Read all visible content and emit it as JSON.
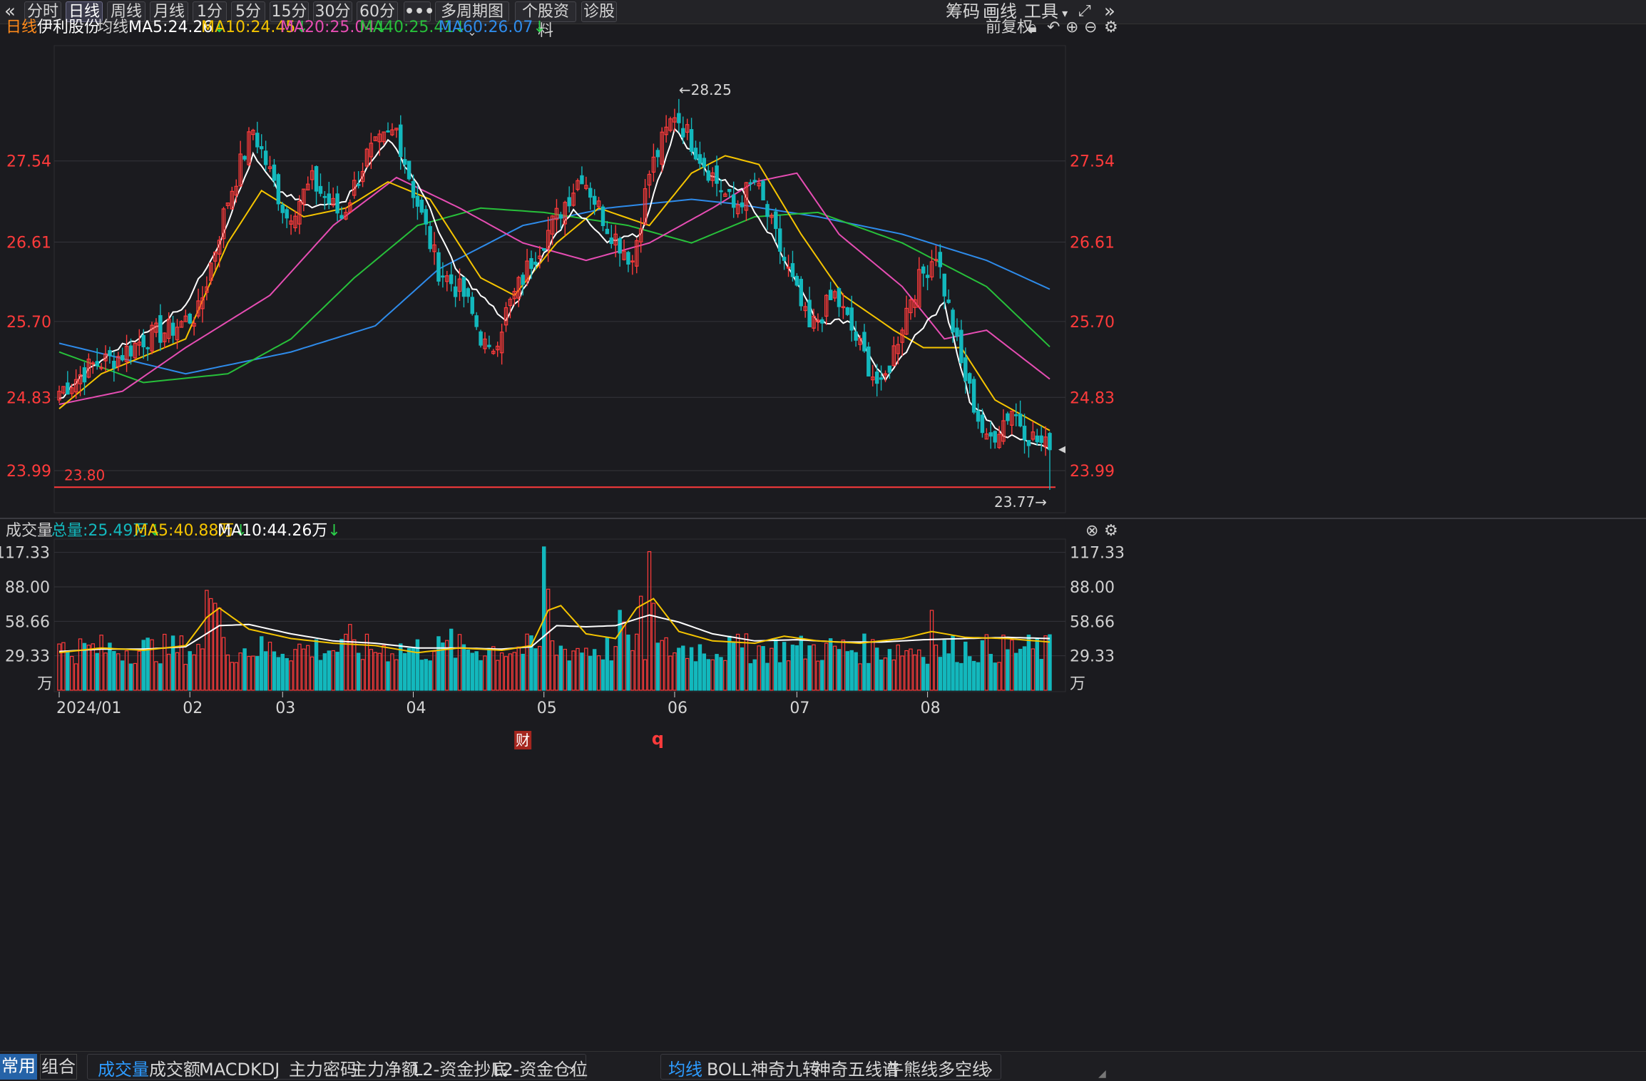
{
  "toolbar": {
    "collapse_icon": "double-chevron-left-icon",
    "periods": [
      "分时",
      "日线",
      "周线",
      "月线",
      "1分",
      "5分",
      "15分",
      "30分",
      "60分"
    ],
    "active_period": "日线",
    "more_label": "•••",
    "multi_period_label": "多周期图",
    "stock_info_label": "个股资料",
    "diagnose_label": "诊股",
    "chips_label": "筹码",
    "draw_label": "画线",
    "tools_label": "工具",
    "fullscreen_icon": "fullscreen-icon",
    "expand_icon": "double-chevron-right-icon"
  },
  "price_header": {
    "period": "日线",
    "stock_name": "伊利股份",
    "ma_label": "均线",
    "ma5": "MA5:24.26",
    "ma10": "MA10:24.45",
    "ma20": "MA20:25.04",
    "ma40": "MA40:25.41",
    "ma60": "MA60:26.07",
    "adjust_label": "前复权"
  },
  "volume_header": {
    "title": "成交量",
    "total": "总量:25.49万",
    "ma5": "MA5:40.88万",
    "ma10": "MA10:44.26万"
  },
  "colors": {
    "up": "#ff3b3b",
    "down": "#13b8bd",
    "ma5": "#ffffff",
    "ma10": "#f5c400",
    "ma20": "#e64db3",
    "ma40": "#27c03a",
    "ma60": "#2e8bea",
    "axis_label": "#ff3b3b",
    "background": "#1b1b1f"
  },
  "chart_data": [
    {
      "type": "candlestick",
      "ylim": [
        23.5,
        28.6
      ],
      "yticks": [
        "27.54",
        "26.61",
        "25.70",
        "24.83",
        "23.99"
      ],
      "support_label": "23.80",
      "support_value": 23.8,
      "high_label": "←28.25",
      "low_label": "23.77→",
      "finance_marker": "财",
      "q_marker": "q",
      "start_value": 24.9,
      "end_value": 24.23,
      "high_value": 28.25,
      "low_value": 23.77,
      "waypoints": [
        [
          0,
          24.9
        ],
        [
          8,
          25.2
        ],
        [
          14,
          25.3
        ],
        [
          20,
          25.5
        ],
        [
          26,
          25.6
        ],
        [
          33,
          25.8
        ],
        [
          40,
          27.1
        ],
        [
          46,
          27.9
        ],
        [
          54,
          26.9
        ],
        [
          60,
          27.3
        ],
        [
          67,
          26.9
        ],
        [
          73,
          27.6
        ],
        [
          80,
          27.9
        ],
        [
          84,
          27.2
        ],
        [
          90,
          26.3
        ],
        [
          96,
          26.0
        ],
        [
          102,
          25.3
        ],
        [
          106,
          25.8
        ],
        [
          112,
          26.4
        ],
        [
          118,
          26.9
        ],
        [
          124,
          27.4
        ],
        [
          130,
          26.8
        ],
        [
          136,
          26.4
        ],
        [
          140,
          27.4
        ],
        [
          146,
          28.1
        ],
        [
          152,
          27.6
        ],
        [
          160,
          27.0
        ],
        [
          165,
          27.3
        ],
        [
          172,
          26.4
        ],
        [
          178,
          25.6
        ],
        [
          184,
          26.0
        ],
        [
          190,
          25.4
        ],
        [
          195,
          24.9
        ],
        [
          202,
          26.0
        ],
        [
          208,
          26.5
        ],
        [
          214,
          25.2
        ],
        [
          220,
          24.3
        ],
        [
          226,
          24.7
        ],
        [
          230,
          24.4
        ],
        [
          235,
          24.23
        ]
      ],
      "ma_lines": {
        "ma60": [
          [
            0,
            25.45
          ],
          [
            30,
            25.1
          ],
          [
            55,
            25.35
          ],
          [
            75,
            25.65
          ],
          [
            90,
            26.3
          ],
          [
            110,
            26.8
          ],
          [
            130,
            27.0
          ],
          [
            150,
            27.1
          ],
          [
            160,
            27.05
          ],
          [
            180,
            26.9
          ],
          [
            200,
            26.7
          ],
          [
            220,
            26.4
          ],
          [
            235,
            26.07
          ]
        ],
        "ma40": [
          [
            0,
            25.35
          ],
          [
            20,
            25.0
          ],
          [
            40,
            25.1
          ],
          [
            55,
            25.5
          ],
          [
            70,
            26.2
          ],
          [
            85,
            26.8
          ],
          [
            100,
            27.0
          ],
          [
            115,
            26.95
          ],
          [
            135,
            26.8
          ],
          [
            150,
            26.6
          ],
          [
            165,
            26.9
          ],
          [
            180,
            26.95
          ],
          [
            200,
            26.6
          ],
          [
            220,
            26.1
          ],
          [
            235,
            25.41
          ]
        ],
        "ma20": [
          [
            0,
            24.75
          ],
          [
            15,
            24.9
          ],
          [
            30,
            25.4
          ],
          [
            50,
            26.0
          ],
          [
            65,
            26.8
          ],
          [
            80,
            27.35
          ],
          [
            95,
            27.0
          ],
          [
            110,
            26.6
          ],
          [
            125,
            26.4
          ],
          [
            140,
            26.6
          ],
          [
            155,
            27.0
          ],
          [
            165,
            27.3
          ],
          [
            175,
            27.4
          ],
          [
            185,
            26.7
          ],
          [
            200,
            26.1
          ],
          [
            210,
            25.5
          ],
          [
            220,
            25.6
          ],
          [
            235,
            25.04
          ]
        ],
        "ma10": [
          [
            0,
            24.7
          ],
          [
            10,
            25.1
          ],
          [
            20,
            25.3
          ],
          [
            30,
            25.5
          ],
          [
            40,
            26.6
          ],
          [
            48,
            27.2
          ],
          [
            58,
            26.9
          ],
          [
            68,
            27.0
          ],
          [
            78,
            27.3
          ],
          [
            88,
            27.1
          ],
          [
            100,
            26.2
          ],
          [
            108,
            26.0
          ],
          [
            118,
            26.6
          ],
          [
            128,
            27.0
          ],
          [
            140,
            26.8
          ],
          [
            150,
            27.4
          ],
          [
            158,
            27.6
          ],
          [
            166,
            27.5
          ],
          [
            176,
            26.7
          ],
          [
            186,
            26.0
          ],
          [
            198,
            25.6
          ],
          [
            205,
            25.4
          ],
          [
            214,
            25.4
          ],
          [
            222,
            24.8
          ],
          [
            235,
            24.45
          ]
        ],
        "ma5": [
          [
            0,
            24.8
          ],
          [
            6,
            25.1
          ],
          [
            14,
            25.4
          ],
          [
            22,
            25.6
          ],
          [
            30,
            25.9
          ],
          [
            38,
            26.6
          ],
          [
            46,
            27.6
          ],
          [
            52,
            27.2
          ],
          [
            60,
            27.0
          ],
          [
            68,
            27.1
          ],
          [
            78,
            27.8
          ],
          [
            86,
            27.2
          ],
          [
            94,
            26.3
          ],
          [
            100,
            26.0
          ],
          [
            106,
            25.7
          ],
          [
            114,
            26.4
          ],
          [
            122,
            27.0
          ],
          [
            130,
            26.6
          ],
          [
            138,
            26.7
          ],
          [
            146,
            27.9
          ],
          [
            154,
            27.4
          ],
          [
            162,
            27.2
          ],
          [
            170,
            26.6
          ],
          [
            180,
            25.7
          ],
          [
            188,
            25.7
          ],
          [
            196,
            25.0
          ],
          [
            204,
            25.6
          ],
          [
            210,
            25.9
          ],
          [
            216,
            24.8
          ],
          [
            224,
            24.4
          ],
          [
            235,
            24.26
          ]
        ]
      }
    },
    {
      "type": "bar",
      "title": "成交量",
      "unit": "万",
      "ylim": [
        0,
        125
      ],
      "yticks": [
        "117.33",
        "88.00",
        "58.66",
        "29.33"
      ],
      "xticks": [
        [
          "2024/01",
          0
        ],
        [
          "02",
          31
        ],
        [
          "03",
          53
        ],
        [
          "04",
          84
        ],
        [
          "05",
          115
        ],
        [
          "06",
          146
        ],
        [
          "07",
          175
        ],
        [
          "08",
          206
        ]
      ],
      "spikes": [
        [
          35,
          85
        ],
        [
          36,
          78
        ],
        [
          37,
          74
        ],
        [
          38,
          70
        ],
        [
          69,
          56
        ],
        [
          93,
          52
        ],
        [
          115,
          122
        ],
        [
          116,
          86
        ],
        [
          133,
          68
        ],
        [
          134,
          58
        ],
        [
          138,
          80
        ],
        [
          140,
          118
        ],
        [
          141,
          74
        ],
        [
          163,
          48
        ],
        [
          207,
          68
        ]
      ],
      "last_bar_down": true,
      "ma5_line": [
        [
          0,
          32
        ],
        [
          10,
          36
        ],
        [
          20,
          34
        ],
        [
          30,
          38
        ],
        [
          35,
          62
        ],
        [
          38,
          70
        ],
        [
          45,
          52
        ],
        [
          55,
          44
        ],
        [
          65,
          40
        ],
        [
          75,
          38
        ],
        [
          85,
          32
        ],
        [
          95,
          36
        ],
        [
          105,
          34
        ],
        [
          112,
          38
        ],
        [
          116,
          68
        ],
        [
          119,
          72
        ],
        [
          125,
          48
        ],
        [
          132,
          44
        ],
        [
          137,
          70
        ],
        [
          141,
          78
        ],
        [
          147,
          50
        ],
        [
          155,
          42
        ],
        [
          165,
          40
        ],
        [
          172,
          46
        ],
        [
          180,
          42
        ],
        [
          190,
          40
        ],
        [
          200,
          44
        ],
        [
          207,
          50
        ],
        [
          215,
          45
        ],
        [
          225,
          44
        ],
        [
          235,
          41
        ]
      ],
      "ma10_line": [
        [
          0,
          33
        ],
        [
          10,
          35
        ],
        [
          20,
          35
        ],
        [
          30,
          37
        ],
        [
          38,
          55
        ],
        [
          45,
          56
        ],
        [
          55,
          48
        ],
        [
          65,
          42
        ],
        [
          75,
          40
        ],
        [
          85,
          36
        ],
        [
          95,
          36
        ],
        [
          105,
          35
        ],
        [
          112,
          37
        ],
        [
          118,
          55
        ],
        [
          125,
          54
        ],
        [
          132,
          55
        ],
        [
          140,
          64
        ],
        [
          147,
          58
        ],
        [
          155,
          48
        ],
        [
          165,
          42
        ],
        [
          175,
          43
        ],
        [
          185,
          41
        ],
        [
          195,
          41
        ],
        [
          205,
          43
        ],
        [
          215,
          44
        ],
        [
          225,
          45
        ],
        [
          235,
          44
        ]
      ]
    }
  ],
  "bottom_tabs": {
    "left": [
      "常用",
      "组合"
    ],
    "indicators": [
      "成交量",
      "成交额",
      "MACD",
      "KDJ",
      "主力密码",
      "主力净额",
      "L2-资金抄底",
      "L2-资金仓位"
    ],
    "overlays": [
      "均线",
      "BOLL",
      "神奇九转",
      "神奇五线谱",
      "牛熊线",
      "多空线"
    ],
    "arrow_icon": "chevron-right-icon",
    "settings_icon": "gear-icon"
  }
}
